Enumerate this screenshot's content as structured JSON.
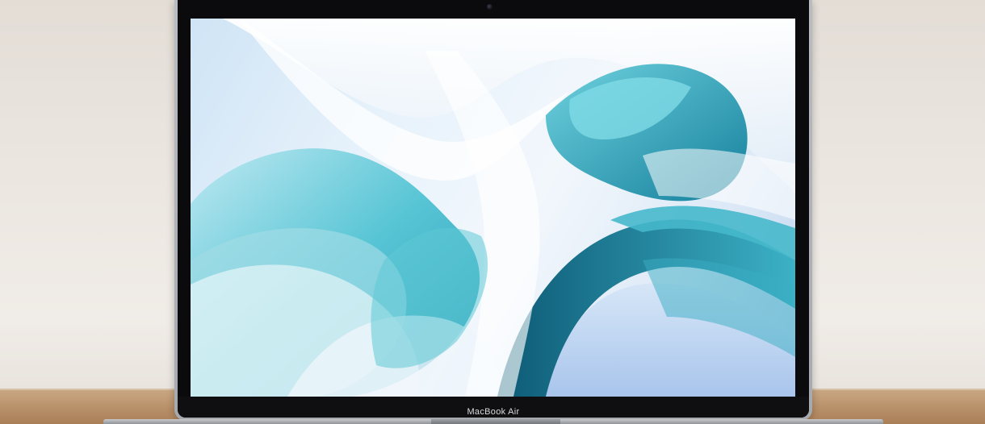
{
  "scene": {
    "device_label": "MacBook Air",
    "wallpaper_colors": [
      "#bfe3f0",
      "#5cc6d6",
      "#1e8fa9",
      "#0e5f7a",
      "#f4f8fc"
    ],
    "background_color": "#ebe6e0",
    "table_color": "#b78f68",
    "bezel_color": "#0b0b0d",
    "frame_color": "#b9bcc1"
  }
}
